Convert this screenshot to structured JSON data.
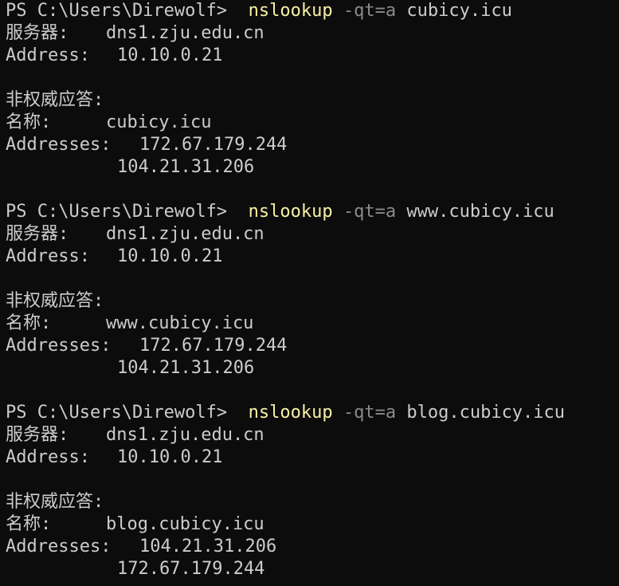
{
  "colors": {
    "background": "#0c0c0c",
    "foreground": "#cccccc",
    "command": "#f9f1a5",
    "flag": "#8a8a8a"
  },
  "blocks": [
    {
      "prompt": "PS C:\\Users\\Direwolf>",
      "command": "nslookup",
      "flag": "-qt=a",
      "target": "cubicy.icu",
      "server_label": "服务器:",
      "server": "dns1.zju.edu.cn",
      "address_label": "Address:",
      "address": "10.10.0.21",
      "nonauth": "非权威应答:",
      "name_label": "名称:",
      "name": "cubicy.icu",
      "addresses_label": "Addresses:",
      "addresses": [
        "172.67.179.244",
        "104.21.31.206"
      ]
    },
    {
      "prompt": "PS C:\\Users\\Direwolf>",
      "command": "nslookup",
      "flag": "-qt=a",
      "target": "www.cubicy.icu",
      "server_label": "服务器:",
      "server": "dns1.zju.edu.cn",
      "address_label": "Address:",
      "address": "10.10.0.21",
      "nonauth": "非权威应答:",
      "name_label": "名称:",
      "name": "www.cubicy.icu",
      "addresses_label": "Addresses:",
      "addresses": [
        "172.67.179.244",
        "104.21.31.206"
      ]
    },
    {
      "prompt": "PS C:\\Users\\Direwolf>",
      "command": "nslookup",
      "flag": "-qt=a",
      "target": "blog.cubicy.icu",
      "server_label": "服务器:",
      "server": "dns1.zju.edu.cn",
      "address_label": "Address:",
      "address": "10.10.0.21",
      "nonauth": "非权威应答:",
      "name_label": "名称:",
      "name": "blog.cubicy.icu",
      "addresses_label": "Addresses:",
      "addresses": [
        "104.21.31.206",
        "172.67.179.244"
      ]
    }
  ]
}
